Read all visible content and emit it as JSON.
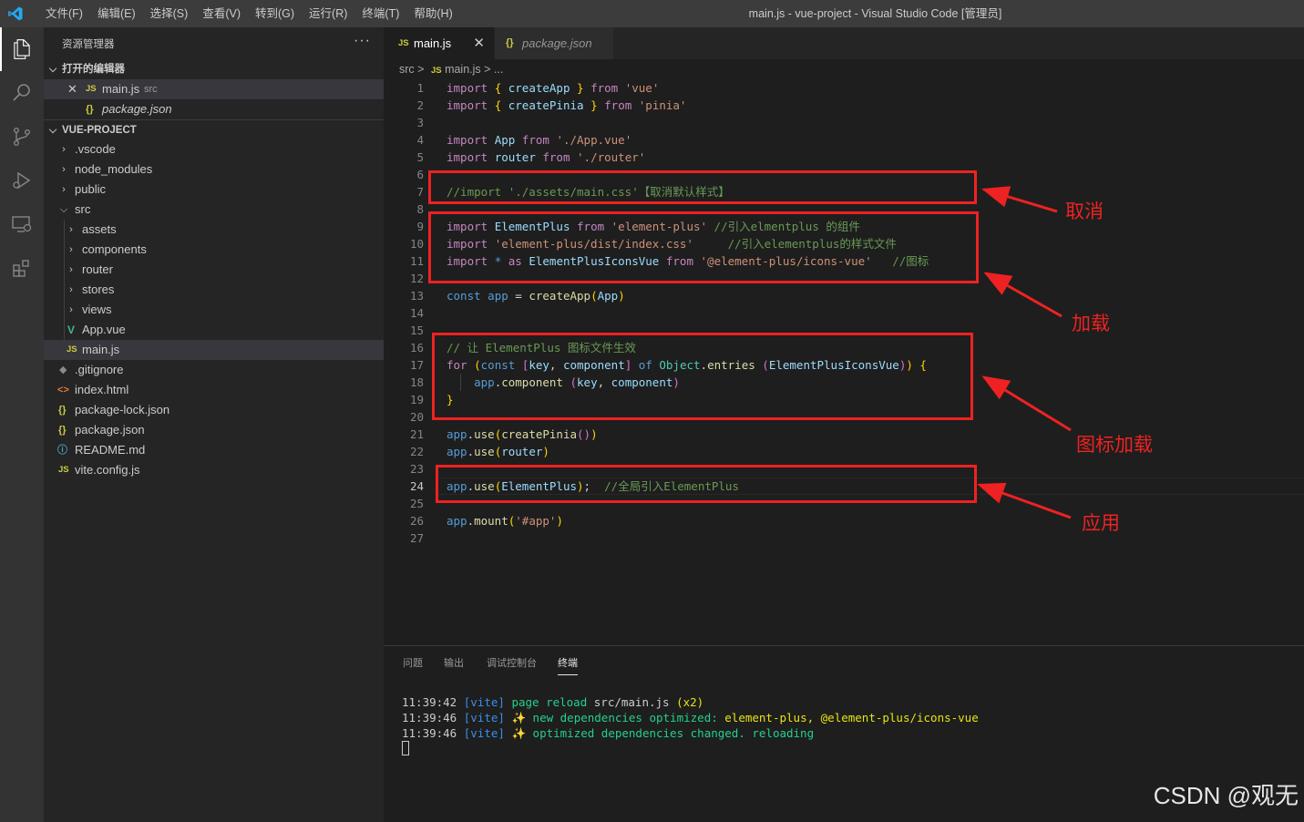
{
  "app": {
    "window_title": "main.js - vue-project - Visual Studio Code [管理员]",
    "menu": [
      "文件(F)",
      "编辑(E)",
      "选择(S)",
      "查看(V)",
      "转到(G)",
      "运行(R)",
      "终端(T)",
      "帮助(H)"
    ]
  },
  "activity_bar": [
    "files-icon",
    "search-icon",
    "source-control-icon",
    "run-debug-icon",
    "remote-explorer-icon",
    "extensions-icon"
  ],
  "sidebar": {
    "title": "资源管理器",
    "more": "···",
    "open_editors_title": "打开的编辑器",
    "open_editors": [
      {
        "icon": "JS",
        "name": "main.js",
        "path": "src"
      },
      {
        "icon": "{}",
        "name": "package.json",
        "path": ""
      }
    ],
    "project_title": "VUE-PROJECT",
    "tree": [
      {
        "name": ".vscode",
        "icon": ">"
      },
      {
        "name": "node_modules",
        "icon": ">"
      },
      {
        "name": "public",
        "icon": ">"
      },
      {
        "name": "src",
        "icon": "v"
      },
      {
        "name": "assets",
        "icon": ">"
      },
      {
        "name": "components",
        "icon": ">"
      },
      {
        "name": "router",
        "icon": ">"
      },
      {
        "name": "stores",
        "icon": ">"
      },
      {
        "name": "views",
        "icon": ">"
      },
      {
        "name": "App.vue",
        "icon": "V"
      },
      {
        "name": "main.js",
        "icon": "JS"
      },
      {
        "name": ".gitignore",
        "icon": "◆"
      },
      {
        "name": "index.html",
        "icon": "<>"
      },
      {
        "name": "package-lock.json",
        "icon": "{}"
      },
      {
        "name": "package.json",
        "icon": "{}"
      },
      {
        "name": "README.md",
        "icon": "ⓘ"
      },
      {
        "name": "vite.config.js",
        "icon": "JS"
      }
    ]
  },
  "tabs": [
    {
      "icon": "JS",
      "label": "main.js",
      "close": "✕"
    },
    {
      "icon": "{}",
      "label": "package.json"
    }
  ],
  "breadcrumb": {
    "folder": "src",
    "sep": ">",
    "icon": "JS",
    "file": "main.js",
    "tail": "..."
  },
  "editor": {
    "line_numbers": [
      "1",
      "2",
      "3",
      "4",
      "5",
      "6",
      "7",
      "8",
      "9",
      "10",
      "11",
      "12",
      "13",
      "14",
      "15",
      "16",
      "17",
      "18",
      "19",
      "20",
      "21",
      "22",
      "23",
      "24",
      "25",
      "26",
      "27"
    ],
    "current_line": "24",
    "tokens": {
      "import": "import",
      "from": "from",
      "as": "as",
      "const": "const",
      "for": "for",
      "of": "of",
      "lb": "{",
      "rb": "}",
      "lp": "(",
      "rp": ")",
      "lk": "[",
      "rk": "]",
      "eq": "=",
      "comma": ",",
      "star": "*",
      "semi": ";",
      "dot": ".",
      "createApp": "createApp",
      "createPinia": "createPinia",
      "App": "App",
      "router": "router",
      "ElementPlus": "ElementPlus",
      "ElementPlusIconsVue": "ElementPlusIconsVue",
      "app": "app",
      "key": "key",
      "component": "component",
      "Object": "Object",
      "entries": "entries",
      "use": "use",
      "mount": "mount",
      "s_vue": "'vue'",
      "s_pinia": "'pinia'",
      "s_appvue": "'./App.vue'",
      "s_router": "'./router'",
      "s_ep": "'element-plus'",
      "s_epcss": "'element-plus/dist/index.css'",
      "s_icons": "'@element-plus/icons-vue'",
      "s_app": "'#app'",
      "c7": "//import './assets/main.css'【取消默认样式】",
      "c9": "//引入elmentplus 的组件",
      "c10": "//引入elementplus的样式文件",
      "c11": "//图标",
      "c16": "// 让 ElementPlus 图标文件生效",
      "c24": "//全局引入ElementPlus"
    }
  },
  "annotations": [
    "取消",
    "加载",
    "图标加载",
    "应用"
  ],
  "panel": {
    "tabs": [
      "问题",
      "输出",
      "调试控制台",
      "终端"
    ],
    "active_tab": "终端",
    "lines": [
      {
        "time": "11:39:42",
        "tag": "[vite]",
        "msg": "page reload",
        "extra": "src/main.js",
        "count": "(x2)"
      },
      {
        "time": "11:39:46",
        "tag": "[vite]",
        "star": "✨",
        "msg": "new dependencies optimized:",
        "extra": "element-plus, @element-plus/icons-vue"
      },
      {
        "time": "11:39:46",
        "tag": "[vite]",
        "star": "✨",
        "msg": "optimized dependencies changed. reloading"
      }
    ]
  },
  "watermark": "CSDN @观无",
  "colors": {
    "accent": "#007acc",
    "annotation_red": "#ee2222"
  }
}
